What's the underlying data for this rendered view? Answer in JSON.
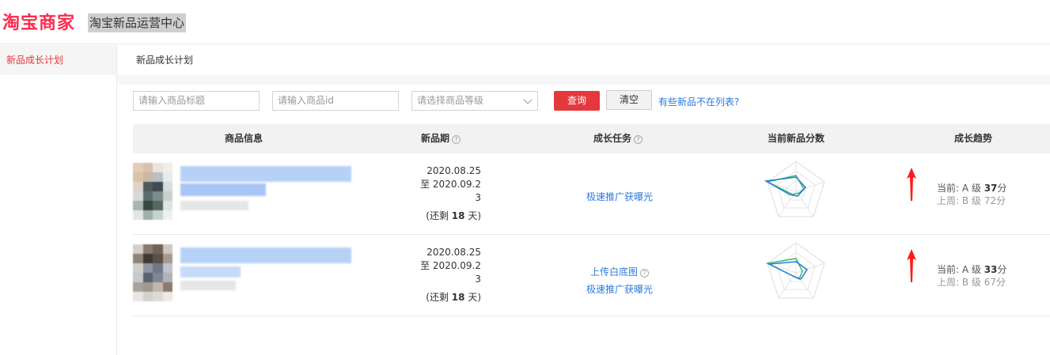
{
  "header": {
    "logo": "淘宝商家",
    "title": "淘宝新品运营中心"
  },
  "sidebar": {
    "items": [
      {
        "label": "新品成长计划"
      }
    ]
  },
  "main": {
    "breadcrumb": "新品成长计划",
    "filters": {
      "title_placeholder": "请输入商品标题",
      "id_placeholder": "请输入商品id",
      "grade_placeholder": "请选择商品等级",
      "query_label": "查询",
      "clear_label": "清空",
      "missing_link": "有些新品不在列表?"
    },
    "table": {
      "columns": [
        "商品信息",
        "新品期",
        "成长任务",
        "当前新品分数",
        "成长趋势"
      ],
      "help_glyph": "?",
      "rows": [
        {
          "period_start": "2020.08.25",
          "period_end_line1": "至 2020.09.2",
          "period_end_line2": "3",
          "remaining_prefix": "(还剩 ",
          "remaining_days": "18",
          "remaining_suffix": " 天)",
          "tasks": [
            "极速推广获曝光"
          ],
          "trend_current_prefix": "当前: A 级 ",
          "trend_current_score": "37",
          "trend_current_suffix": "分",
          "trend_previous": "上周: B 级 72分"
        },
        {
          "period_start": "2020.08.25",
          "period_end_line1": "至 2020.09.2",
          "period_end_line2": "3",
          "remaining_prefix": "(还剩 ",
          "remaining_days": "18",
          "remaining_suffix": " 天)",
          "tasks": [
            "上传白底图",
            "极速推广获曝光"
          ],
          "trend_current_prefix": "当前: A 级 ",
          "trend_current_score": "33",
          "trend_current_suffix": "分",
          "trend_previous": "上周: B 级 67分"
        }
      ]
    }
  },
  "colors": {
    "brand": "#ff2a4e",
    "primary_button": "#e4393c",
    "link": "#2d7ad9",
    "radar_blue": "#2d7ad9",
    "radar_green": "#2fbf71",
    "trend_arrow": "#ff1a1a"
  },
  "icons": {
    "help": "help-circle-icon",
    "dropdown": "chevron-down-icon",
    "trend_up": "arrow-up-icon"
  }
}
